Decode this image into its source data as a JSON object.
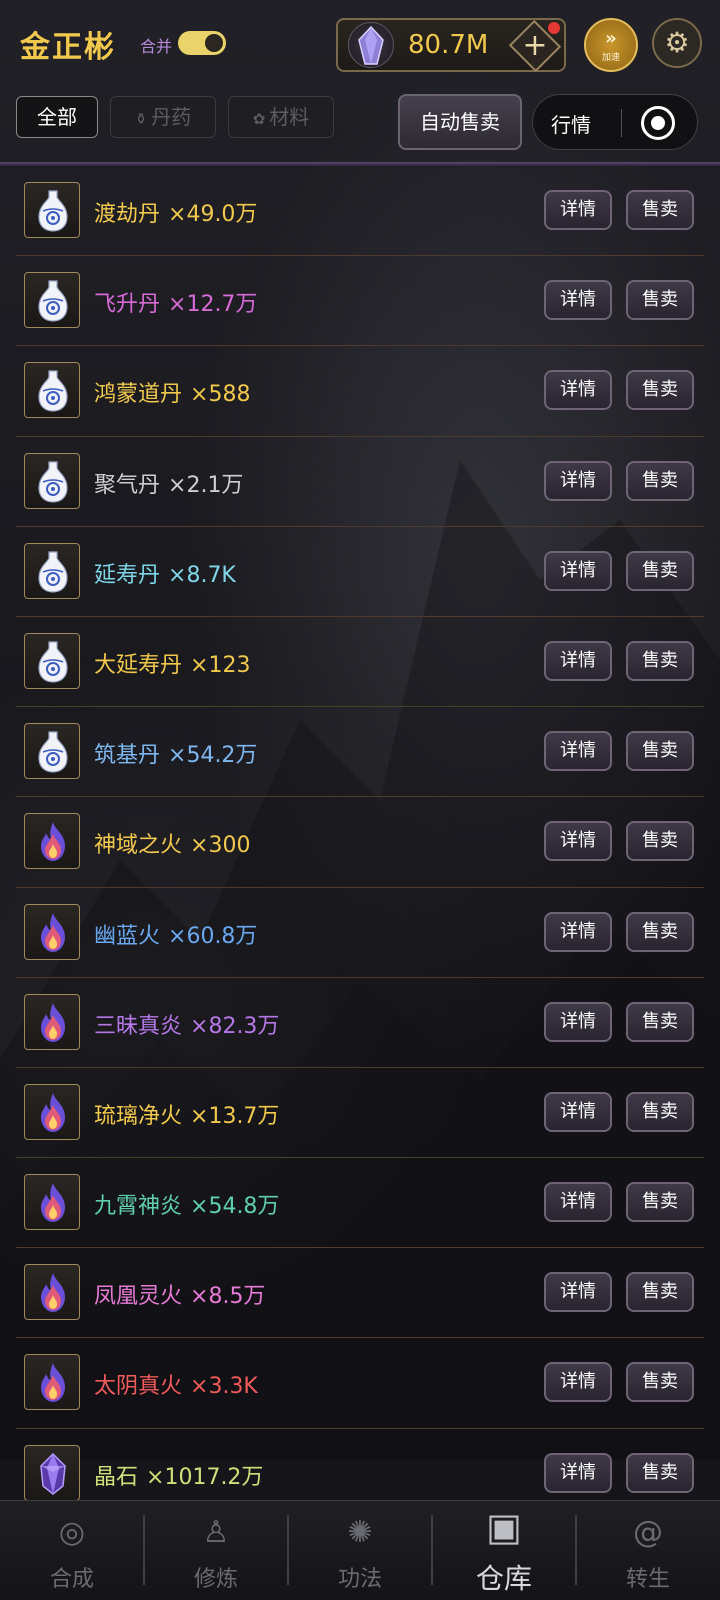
{
  "header": {
    "player_name": "金正彬",
    "merge_label": "合并",
    "merge_on": true,
    "currency_value": "80.7M",
    "add_label": "+",
    "speed_arrows": "»",
    "speed_label": "加速",
    "settings_icon": "gear-icon"
  },
  "filters": {
    "tab_all": "全部",
    "tab_pills": "丹药",
    "tab_materials": "材料",
    "auto_sell": "自动售卖",
    "market": "行情"
  },
  "buttons": {
    "detail": "详情",
    "sell": "售卖"
  },
  "items": [
    {
      "name": "渡劫丹",
      "count": "×49.0万",
      "color": "#f2c94c",
      "icon": "vase-icon"
    },
    {
      "name": "飞升丹",
      "count": "×12.7万",
      "color": "#d86ad8",
      "icon": "vase-icon"
    },
    {
      "name": "鸿蒙道丹",
      "count": "×588",
      "color": "#f2c94c",
      "icon": "vase-icon"
    },
    {
      "name": "聚气丹",
      "count": "×2.1万",
      "color": "#cfcfcf",
      "icon": "vase-icon"
    },
    {
      "name": "延寿丹",
      "count": "×8.7K",
      "color": "#7fd6e8",
      "icon": "vase-icon"
    },
    {
      "name": "大延寿丹",
      "count": "×123",
      "color": "#f2c94c",
      "icon": "vase-icon"
    },
    {
      "name": "筑基丹",
      "count": "×54.2万",
      "color": "#7fb8f0",
      "icon": "vase-icon"
    },
    {
      "name": "神域之火",
      "count": "×300",
      "color": "#f2c94c",
      "icon": "flame-icon"
    },
    {
      "name": "幽蓝火",
      "count": "×60.8万",
      "color": "#6aa8f0",
      "icon": "flame-icon"
    },
    {
      "name": "三昧真炎",
      "count": "×82.3万",
      "color": "#b678e8",
      "icon": "flame-icon"
    },
    {
      "name": "琉璃净火",
      "count": "×13.7万",
      "color": "#f2c94c",
      "icon": "flame-icon"
    },
    {
      "name": "九霄神炎",
      "count": "×54.8万",
      "color": "#5fcfb0",
      "icon": "flame-icon"
    },
    {
      "name": "凤凰灵火",
      "count": "×8.5万",
      "color": "#e87ad8",
      "icon": "flame-icon"
    },
    {
      "name": "太阴真火",
      "count": "×3.3K",
      "color": "#f05a5a",
      "icon": "flame-icon"
    },
    {
      "name": "晶石",
      "count": "×1017.2万",
      "color": "#cfe07a",
      "icon": "crystal-icon"
    }
  ],
  "nav": [
    {
      "label": "合成",
      "icon": "synthesis-icon",
      "active": false
    },
    {
      "label": "修炼",
      "icon": "meditation-icon",
      "active": false
    },
    {
      "label": "功法",
      "icon": "technique-icon",
      "active": false
    },
    {
      "label": "仓库",
      "icon": "chest-icon",
      "active": true
    },
    {
      "label": "转生",
      "icon": "rebirth-icon",
      "active": false
    }
  ]
}
